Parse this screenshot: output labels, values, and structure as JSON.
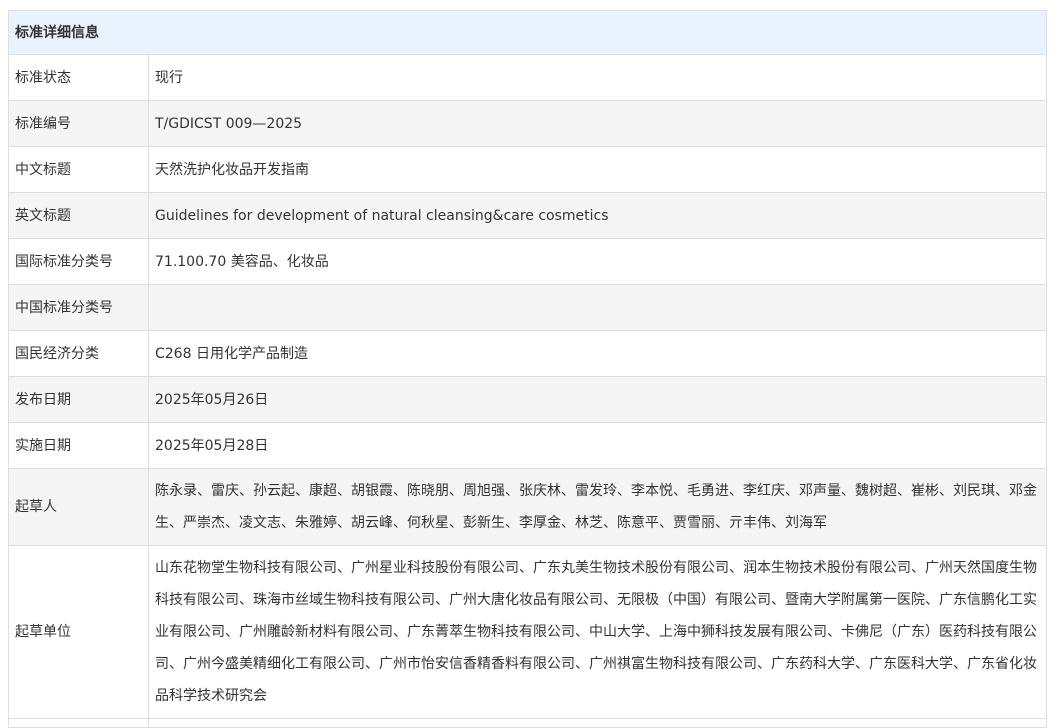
{
  "section_title": "标准详细信息",
  "rows": [
    {
      "label": "标准状态",
      "value": "现行"
    },
    {
      "label": "标准编号",
      "value": "T/GDICST 009—2025"
    },
    {
      "label": "中文标题",
      "value": "天然洗护化妆品开发指南"
    },
    {
      "label": "英文标题",
      "value": "Guidelines for development of natural cleansing&care cosmetics"
    },
    {
      "label": "国际标准分类号",
      "value": "71.100.70 美容品、化妆品"
    },
    {
      "label": "中国标准分类号",
      "value": ""
    },
    {
      "label": "国民经济分类",
      "value": "C268 日用化学产品制造"
    },
    {
      "label": "发布日期",
      "value": "2025年05月26日"
    },
    {
      "label": "实施日期",
      "value": "2025年05月28日"
    },
    {
      "label": "起草人",
      "value": "陈永录、雷庆、孙云起、康超、胡银霞、陈晓朋、周旭强、张庆林、雷发玲、李本悦、毛勇进、李红庆、邓声量、魏树超、崔彬、刘民琪、邓金生、严崇杰、凌文志、朱雅婷、胡云峰、何秋星、彭新生、李厚金、林芝、陈意平、贾雪丽、亓丰伟、刘海军"
    },
    {
      "label": "起草单位",
      "value": "山东花物堂生物科技有限公司、广州星业科技股份有限公司、广东丸美生物技术股份有限公司、润本生物技术股份有限公司、广州天然国度生物科技有限公司、珠海市丝域生物科技有限公司、广州大唐化妆品有限公司、无限极（中国）有限公司、暨南大学附属第一医院、广东信鹏化工实业有限公司、广州雕龄新材料有限公司、广东菁萃生物科技有限公司、中山大学、上海中狮科技发展有限公司、卡佛尼（广东）医药科技有限公司、广州今盛美精细化工有限公司、广州市怡安信香精香料有限公司、广州祺富生物科技有限公司、广东药科大学、广东医科大学、广东省化妆品科学技术研究会"
    }
  ]
}
